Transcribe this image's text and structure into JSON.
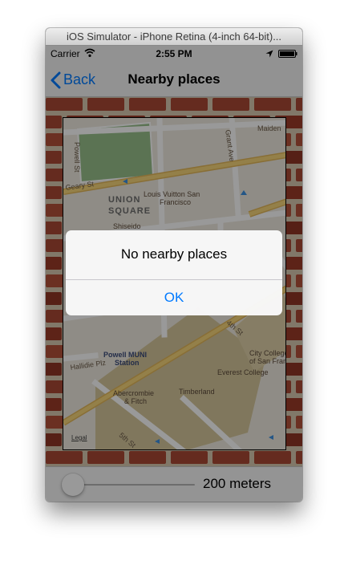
{
  "window": {
    "title": "iOS Simulator - iPhone Retina (4-inch 64-bit)..."
  },
  "status_bar": {
    "carrier": "Carrier",
    "time": "2:55 PM",
    "icons": [
      "wifi-icon",
      "location-arrow-icon",
      "battery-icon"
    ]
  },
  "nav_bar": {
    "back_label": "Back",
    "title": "Nearby places"
  },
  "map": {
    "streets": [
      "Maiden",
      "Powell St",
      "Grant Ave",
      "Geary St",
      "Hallidie Plz",
      "5th St",
      "4th St"
    ],
    "district": "UNION SQUARE",
    "places": [
      "Louis Vuitton San",
      "Francisco",
      "Shiseido",
      "City College",
      "of San Franc",
      "Everest College",
      "Timberland",
      "Abercrombie",
      "& Fitch"
    ],
    "transit": [
      "Powell MUNI",
      "Station"
    ],
    "legal": "Legal"
  },
  "toolbar": {
    "slider_value": 0.0,
    "distance_label": "200 meters"
  },
  "alert": {
    "title": "No nearby places",
    "ok_label": "OK"
  },
  "colors": {
    "ios_blue": "#007aff",
    "brick": "#a94834",
    "mortar": "#d7c8b0",
    "map_park": "#98c08a",
    "map_building": "#d4c49a",
    "map_major_road": "#f2c868"
  }
}
